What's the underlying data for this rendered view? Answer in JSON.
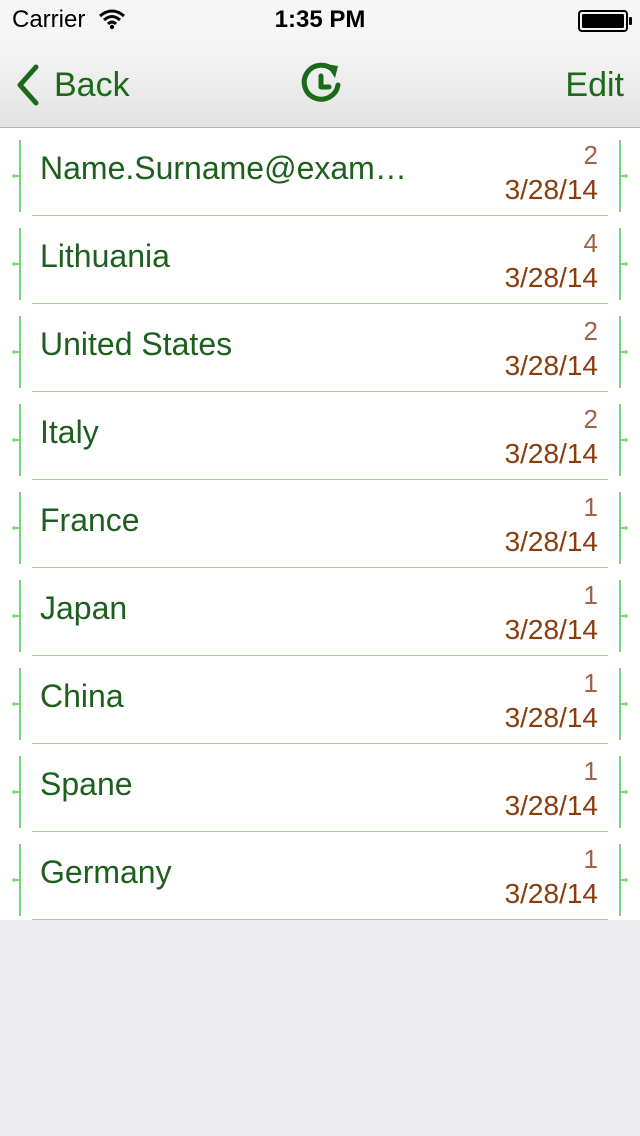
{
  "status": {
    "carrier": "Carrier",
    "time": "1:35 PM"
  },
  "nav": {
    "back_label": "Back",
    "edit_label": "Edit",
    "refresh_icon": "refresh-clock-icon"
  },
  "colors": {
    "accent": "#1a6a1a",
    "title_text": "#1e5e1e",
    "count_text": "#a0624a",
    "date_text": "#8a3c0c",
    "divider": "#8cdd8c",
    "background": "#ebebf0"
  },
  "rows": [
    {
      "title": "Name.Surname@exam…",
      "count": "2",
      "date": "3/28/14"
    },
    {
      "title": "Lithuania",
      "count": "4",
      "date": "3/28/14"
    },
    {
      "title": "United States",
      "count": "2",
      "date": "3/28/14"
    },
    {
      "title": "Italy",
      "count": "2",
      "date": "3/28/14"
    },
    {
      "title": "France",
      "count": "1",
      "date": "3/28/14"
    },
    {
      "title": "Japan",
      "count": "1",
      "date": "3/28/14"
    },
    {
      "title": "China",
      "count": "1",
      "date": "3/28/14"
    },
    {
      "title": "Spane",
      "count": "1",
      "date": "3/28/14"
    },
    {
      "title": "Germany",
      "count": "1",
      "date": "3/28/14"
    }
  ]
}
